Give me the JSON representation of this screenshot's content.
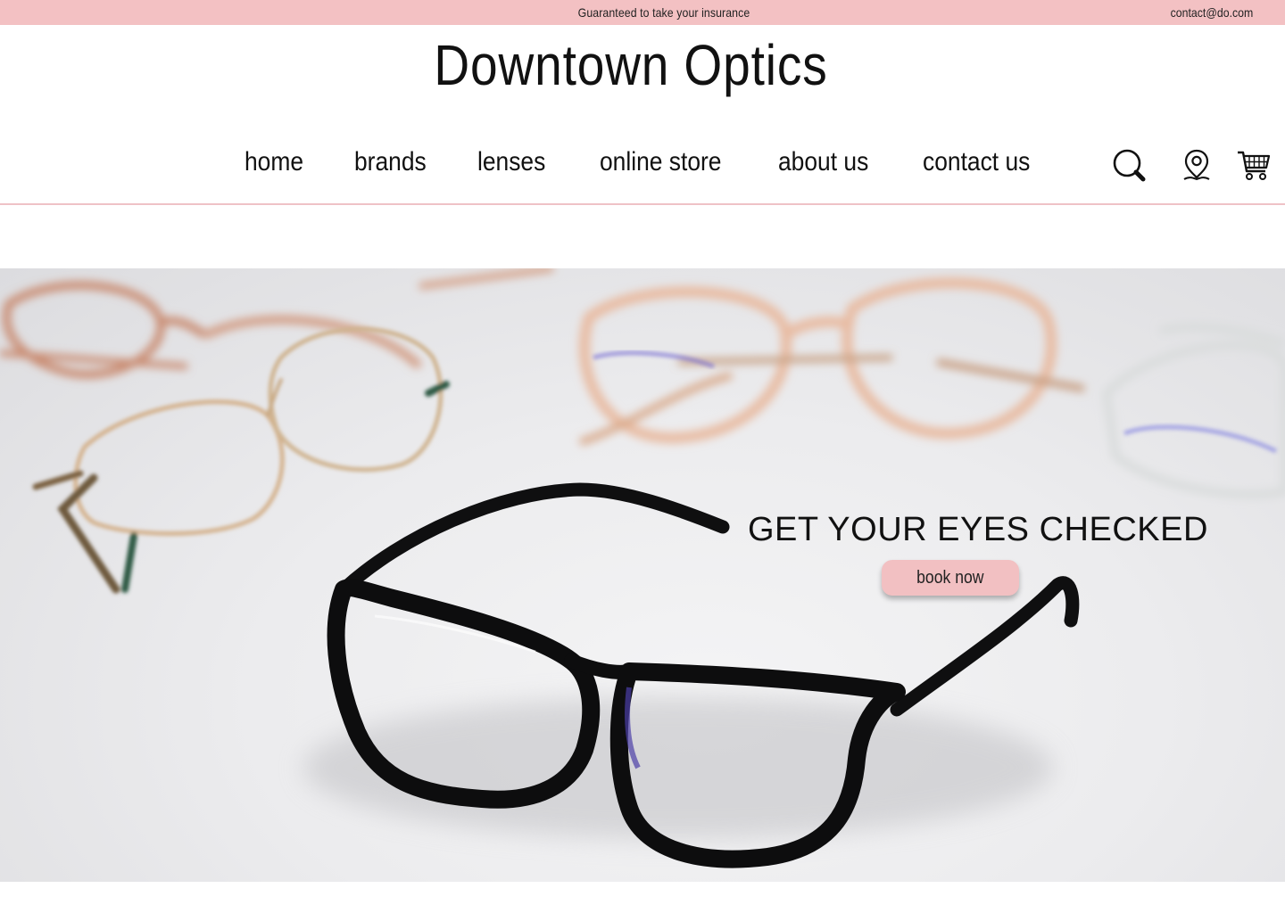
{
  "topbar": {
    "promo": "Guaranteed to take your insurance",
    "email": "contact@do.com",
    "background": "#f3c1c3"
  },
  "header": {
    "logo": "Downtown Optics"
  },
  "nav": {
    "items": [
      {
        "label": "home"
      },
      {
        "label": "brands"
      },
      {
        "label": "lenses"
      },
      {
        "label": "online store"
      },
      {
        "label": "about us"
      },
      {
        "label": "contact us"
      }
    ],
    "icons": [
      "search-icon",
      "location-pin-icon",
      "shopping-cart-icon"
    ]
  },
  "hero": {
    "title": "GET YOUR EYES CHECKED",
    "cta": "book now",
    "cta_color": "#f2c0c2",
    "image": "eyeglasses-photo"
  }
}
